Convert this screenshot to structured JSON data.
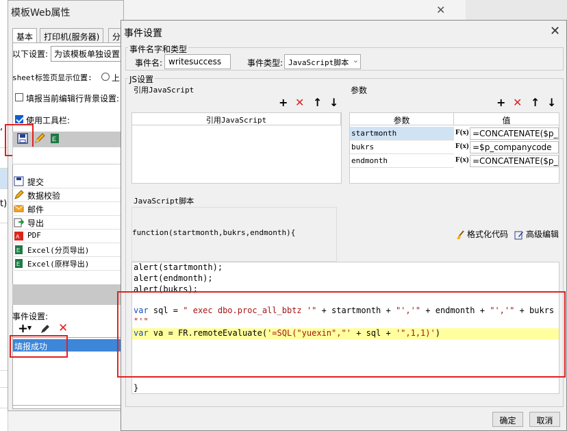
{
  "background": {
    "left_texts": [
      ",",
      "t)"
    ]
  },
  "back_dialog": {
    "title": "模板Web属性",
    "close_icon": "close-icon",
    "tabs": [
      "基本",
      "打印机(服务器)",
      "分"
    ],
    "settings_label": "以下设置:",
    "settings_value": "为该模板单独设置",
    "sheet_label": "sheet标签页显示位置:",
    "sheet_radio_label": "上",
    "fill_bg_label": "填报当前编辑行背景设置:",
    "use_toolbar_label": "使用工具栏:",
    "toolbar_icons": [
      "save-icon",
      "pencil-icon",
      "excel-icon"
    ],
    "list_items": [
      {
        "icon": "submit-icon",
        "label": "提交"
      },
      {
        "icon": "validate-icon",
        "label": "数据校验"
      },
      {
        "icon": "mail-icon",
        "label": "邮件"
      },
      {
        "icon": "export-icon",
        "label": "导出"
      },
      {
        "icon": "pdf-icon",
        "label": "PDF"
      },
      {
        "icon": "excel-icon",
        "label": "Excel(分页导出)"
      },
      {
        "icon": "excel-icon",
        "label": "Excel(原样导出)"
      }
    ],
    "event_settings_label": "事件设置:",
    "event_tools": [
      "add-icon",
      "edit-icon",
      "delete-icon"
    ],
    "event_item": "填报成功"
  },
  "dialog": {
    "title": "事件设置",
    "name_type_section": "事件名字和类型",
    "event_name_label": "事件名:",
    "event_name_value": "writesuccess",
    "event_type_label": "事件类型:",
    "event_type_value": "JavaScript脚本",
    "js_section": "JS设置",
    "ref_js_label": "引用JavaScript",
    "ref_js_header": "引用JavaScript",
    "params_label": "参数",
    "params_headers": [
      "参数",
      "值"
    ],
    "params": [
      {
        "name": "startmonth",
        "value": "=CONCATENATE($p_"
      },
      {
        "name": "bukrs",
        "value": "=$p_companycode"
      },
      {
        "name": "endmonth",
        "value": "=CONCATENATE($p_"
      }
    ],
    "fx_label": "F(x)",
    "js_script_label": "JavaScript脚本",
    "function_signature": "function(startmonth,bukrs,endmonth){",
    "format_code_label": "格式化代码",
    "advanced_edit_label": "高级编辑",
    "code_lines": [
      "alert(startmonth);",
      "alert(endmonth);",
      "alert(bukrs);"
    ],
    "code_sql_kw": "var",
    "code_sql_rest": " sql = ",
    "code_sql_str1": "\" exec dbo.proc_all_bbtz '\"",
    "code_sql_mid1": " + startmonth + ",
    "code_sql_str2": "\"','\"",
    "code_sql_mid2": " + endmonth + ",
    "code_sql_str3": "\"','\"",
    "code_sql_mid3": " + bukrs +",
    "code_sql_cont": "\"'\"",
    "code_va_kw": "var",
    "code_va_rest": " va = FR.remoteEvaluate(",
    "code_va_str1": "'=SQL(\"yuexin\",\"'",
    "code_va_mid": " + sql + ",
    "code_va_str2": "'\",1,1)'",
    "code_va_end": ")",
    "closing_brace": "}",
    "ok_button": "确定",
    "cancel_button": "取消"
  },
  "colors": {
    "highlight_box": "#e02020",
    "selected_item": "#3d86d8",
    "code_highlight": "#ffff9e"
  }
}
